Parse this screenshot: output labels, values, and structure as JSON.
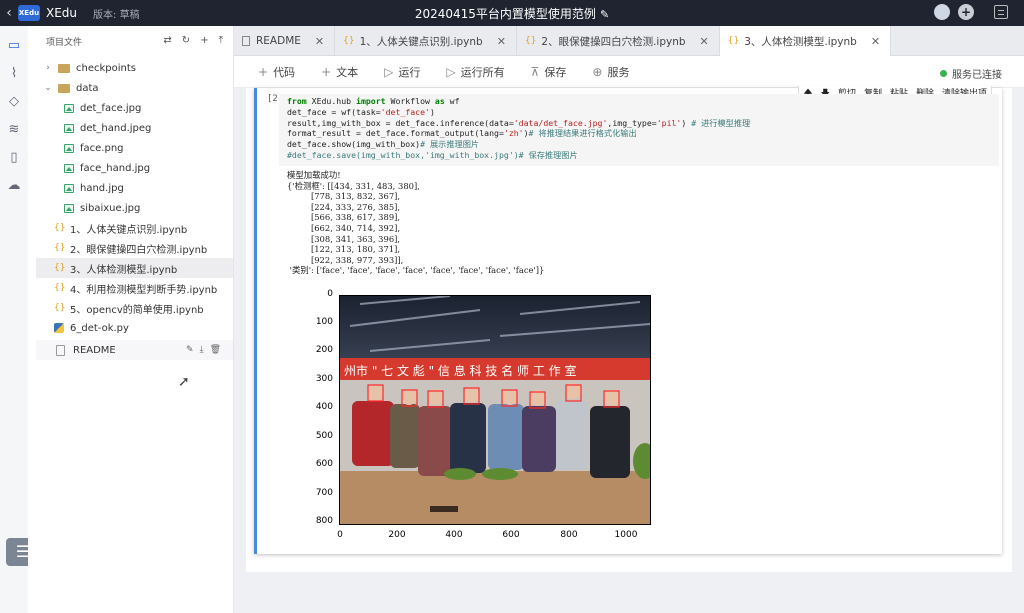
{
  "app": {
    "name": "XEdu",
    "version": "版本: 草稿",
    "logo_text": "XEdu"
  },
  "document_title": "20240415平台内置模型使用范例",
  "sidebar": {
    "title": "项目文件",
    "items": [
      {
        "label": "checkpoints",
        "type": "folder"
      },
      {
        "label": "data",
        "type": "folder-open"
      },
      {
        "label": "det_face.jpg",
        "type": "image"
      },
      {
        "label": "det_hand.jpeg",
        "type": "image"
      },
      {
        "label": "face.png",
        "type": "image"
      },
      {
        "label": "face_hand.jpg",
        "type": "image"
      },
      {
        "label": "hand.jpg",
        "type": "image"
      },
      {
        "label": "sibaixue.jpg",
        "type": "image"
      },
      {
        "label": "1、人体关键点识别.ipynb",
        "type": "notebook"
      },
      {
        "label": "2、眼保健操四白穴检测.ipynb",
        "type": "notebook"
      },
      {
        "label": "3、人体检测模型.ipynb",
        "type": "notebook"
      },
      {
        "label": "4、利用检测模型判断手势.ipynb",
        "type": "notebook"
      },
      {
        "label": "5、opencv的简单使用.ipynb",
        "type": "notebook"
      },
      {
        "label": "6_det-ok.py",
        "type": "python"
      },
      {
        "label": "README",
        "type": "doc"
      }
    ]
  },
  "tabs": [
    {
      "label": "README"
    },
    {
      "label": "1、人体关键点识别.ipynb"
    },
    {
      "label": "2、眼保健操四白穴检测.ipynb"
    },
    {
      "label": "3、人体检测模型.ipynb"
    }
  ],
  "toolbar": {
    "code": "代码",
    "text": "文本",
    "run": "运行",
    "run_all": "运行所有",
    "save": "保存",
    "service": "服务",
    "status": "服务已连接"
  },
  "cell": {
    "prompt": "[2]",
    "tools": [
      "剪切",
      "复制",
      "粘贴",
      "删除",
      "清除输出项"
    ],
    "output_lines": [
      "模型加载成功!",
      "{'检测框': [[434, 331, 483, 380],",
      "         [778, 313, 832, 367],",
      "         [224, 333, 276, 385],",
      "         [566, 338, 617, 389],",
      "         [662, 340, 714, 392],",
      "         [308, 341, 363, 396],",
      "         [122, 313, 180, 371],",
      "         [922, 338, 977, 393]],",
      " '类别': ['face', 'face', 'face', 'face', 'face', 'face', 'face', 'face']}"
    ]
  },
  "plot": {
    "yticks": [
      "0",
      "100",
      "200",
      "300",
      "400",
      "500",
      "600",
      "700",
      "800"
    ],
    "xticks": [
      "0",
      "200",
      "400",
      "600",
      "800",
      "1000"
    ],
    "banner_text": "州市 \" 七 文 彪 \" 信 息 科 技 名 师 工 作 室"
  }
}
